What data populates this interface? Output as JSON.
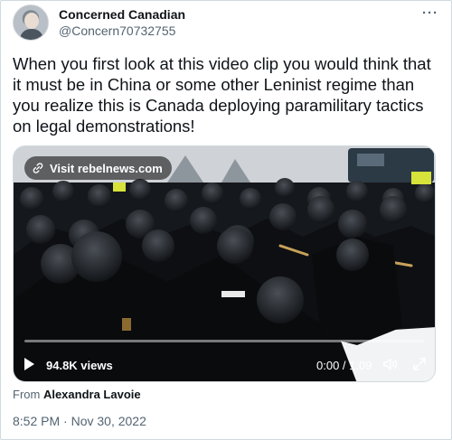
{
  "author": {
    "display_name": "Concerned Canadian",
    "handle": "@Concern70732755"
  },
  "more_menu": {
    "label": "···"
  },
  "tweet_text": "When you first look at this video clip you would think that it must be in China or some other Leninist regime than you realize this is Canada deploying paramilitary tactics on legal demonstrations!",
  "video": {
    "visit_link": "Visit rebelnews.com",
    "views": "94.8K views",
    "time": "0:00 / 1:09",
    "progress": 0.0,
    "icons": [
      "link-icon",
      "play-icon",
      "volume-icon",
      "fullscreen-icon"
    ]
  },
  "attribution": {
    "prefix": "From ",
    "source": "Alexandra Lavoie"
  },
  "timestamp": "8:52 PM · Nov 30, 2022",
  "colors": {
    "accent": "#1d9bf0",
    "secondary_text": "#536471",
    "border": "#cfd9de"
  }
}
